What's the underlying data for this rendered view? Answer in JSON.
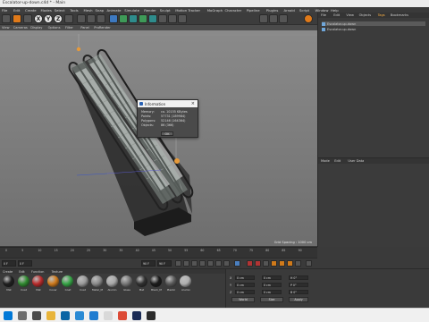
{
  "window": {
    "title": "Escalator-up-down.c4d * - Main"
  },
  "menu": [
    "File",
    "Edit",
    "Create",
    "Modes",
    "Select",
    "Tools",
    "Mesh",
    "Snap",
    "Animate",
    "Simulate",
    "Render",
    "Sculpt",
    "Motion Tracker",
    "MoGraph",
    "Character",
    "Pipeline",
    "Plugins",
    "Arnold",
    "Script",
    "Window",
    "Help"
  ],
  "viewport_menu": [
    "View",
    "Cameras",
    "Display",
    "Options",
    "Filter",
    "Panel",
    "ProRender"
  ],
  "viewport": {
    "grid_spacing": "Grid Spacing : 1000 cm"
  },
  "info_dialog": {
    "title": "Information",
    "rows": [
      {
        "key": "Memory:",
        "value": "ca. 10155 KBytes"
      },
      {
        "key": "Points:",
        "value": "57731 (189984)"
      },
      {
        "key": "Polygons:",
        "value": "52146 (164364)"
      },
      {
        "key": "Objects:",
        "value": "86 (366)"
      }
    ],
    "ok_label": "OK"
  },
  "objects_panel": {
    "menu": [
      "File",
      "Edit",
      "View",
      "Objects",
      "Tags",
      "Bookmarks"
    ],
    "active": "Tags",
    "items": [
      "Escalator-up-down",
      "Escalator-up-down"
    ]
  },
  "attributes_panel": {
    "menu": [
      "Mode",
      "Edit",
      "User Data"
    ]
  },
  "timeline": {
    "ticks": [
      "0",
      "5",
      "10",
      "15",
      "20",
      "25",
      "30",
      "35",
      "40",
      "45",
      "50",
      "55",
      "60",
      "65",
      "70",
      "75",
      "80",
      "85",
      "90"
    ],
    "start": "0 F",
    "end": "90 F",
    "current": "0 F",
    "frame_end": "90 F"
  },
  "materials": {
    "menu": [
      "Create",
      "Edit",
      "Function",
      "Texture"
    ],
    "items": [
      {
        "name": "Mat",
        "color": "#1e1e1e"
      },
      {
        "name": "Coat",
        "color": "#2f8a2f"
      },
      {
        "name": "Mat",
        "color": "#b92a2a"
      },
      {
        "name": "Cover",
        "color": "#d07a1a"
      },
      {
        "name": "Coat",
        "color": "#35a545"
      },
      {
        "name": "Coat",
        "color": "#9a9a9a"
      },
      {
        "name": "Metal_M",
        "color": "#8a8a8a"
      },
      {
        "name": "Alumin",
        "color": "#a8a8a8"
      },
      {
        "name": "Glass",
        "color": "#777777"
      },
      {
        "name": "Mat",
        "color": "#303030"
      },
      {
        "name": "Black_M",
        "color": "#1a1a1a"
      },
      {
        "name": "Plastic",
        "color": "#5a5a5a"
      },
      {
        "name": "Alumin",
        "color": "#b0b0b0"
      }
    ]
  },
  "coordinates": {
    "labels": [
      "X",
      "Y",
      "Z"
    ],
    "pos": [
      "0 cm",
      "0 cm",
      "0 cm"
    ],
    "size": [
      "0 cm",
      "0 cm",
      "0 cm"
    ],
    "rot": [
      "H 0°",
      "P 0°",
      "B 0°"
    ],
    "mode_a": "World",
    "mode_b": "Size",
    "apply_label": "Apply"
  },
  "accent": "#e07a1a"
}
